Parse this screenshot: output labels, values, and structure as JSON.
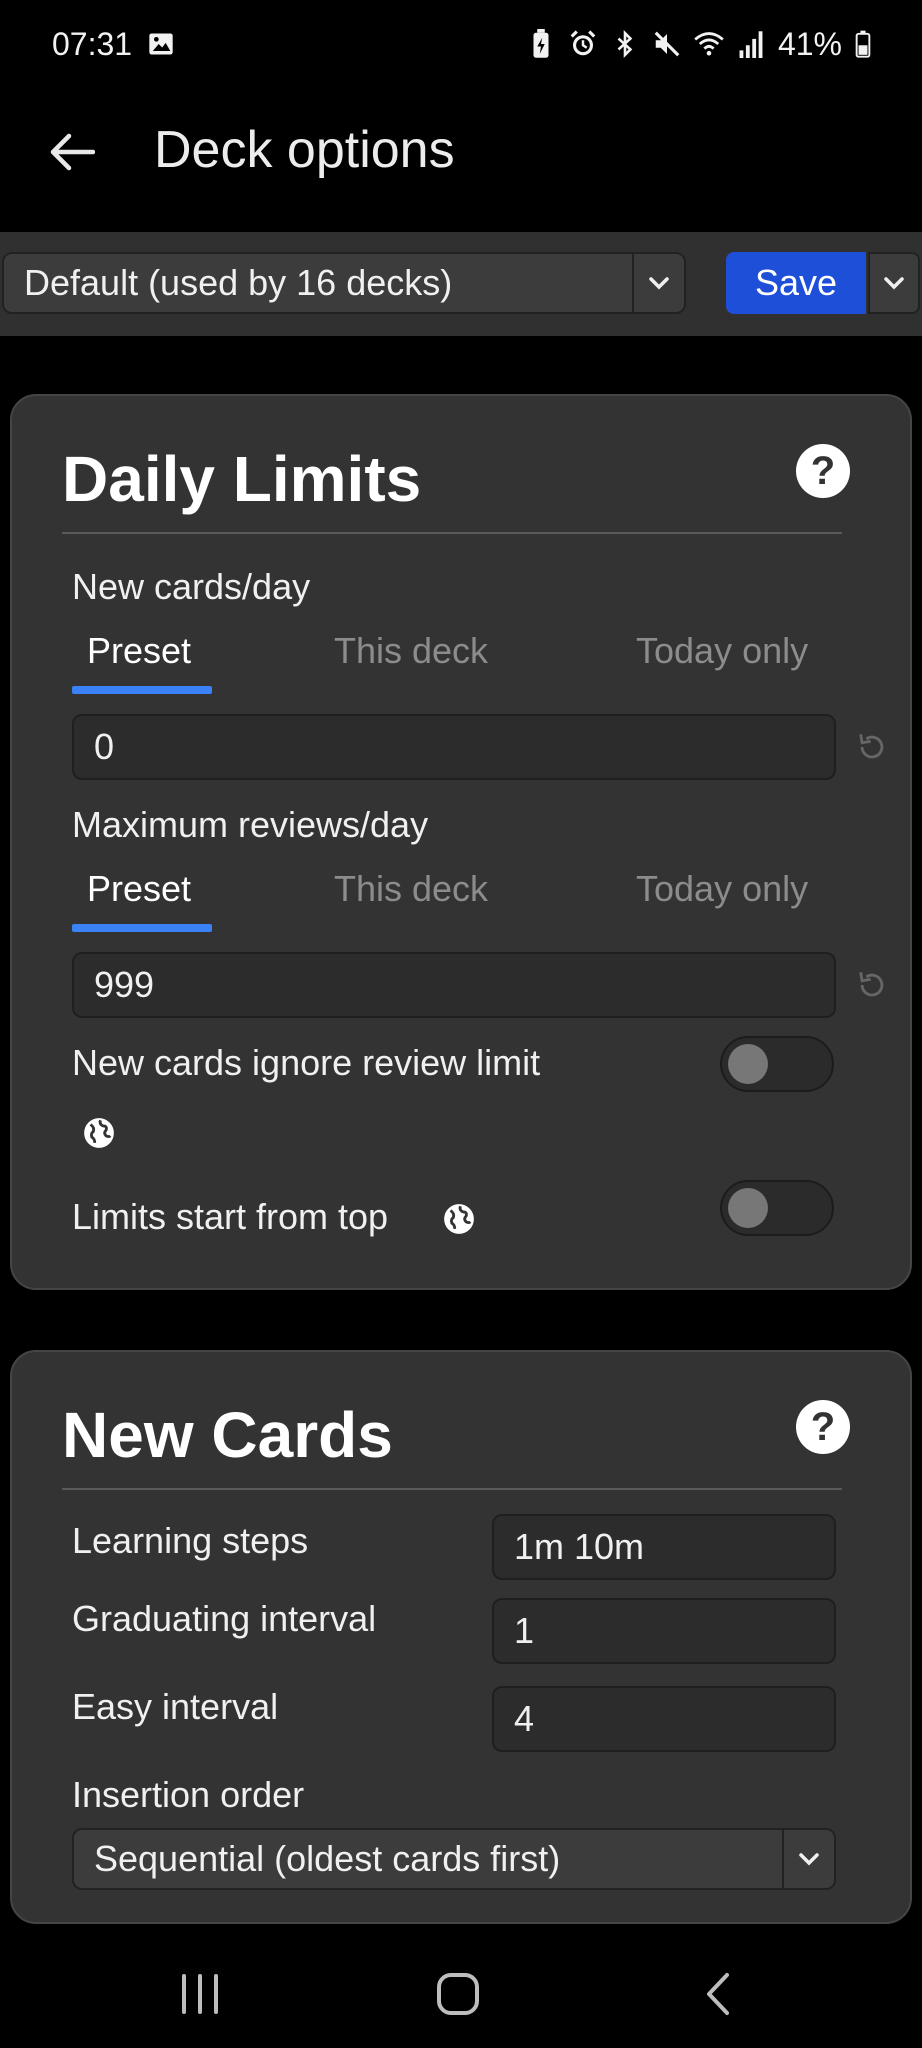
{
  "status_bar": {
    "time": "07:31",
    "battery": "41%",
    "icons": [
      "image-icon",
      "battery-saver-icon",
      "alarm-icon",
      "bluetooth-icon",
      "mute-icon",
      "wifi-icon",
      "signal-icon",
      "battery-icon"
    ]
  },
  "app_bar": {
    "title": "Deck options"
  },
  "toolbar": {
    "preset_value": "Default (used by 16 decks)",
    "save_label": "Save"
  },
  "daily_limits": {
    "title": "Daily Limits",
    "new_cards": {
      "label": "New cards/day",
      "tabs": [
        "Preset",
        "This deck",
        "Today only"
      ],
      "active_tab": "Preset",
      "value": "0"
    },
    "max_reviews": {
      "label": "Maximum reviews/day",
      "tabs": [
        "Preset",
        "This deck",
        "Today only"
      ],
      "active_tab": "Preset",
      "value": "999"
    },
    "ignore_review_limit": {
      "label": "New cards ignore review limit",
      "enabled": false
    },
    "limits_from_top": {
      "label": "Limits start from top",
      "enabled": false
    }
  },
  "new_cards": {
    "title": "New Cards",
    "learning_steps": {
      "label": "Learning steps",
      "value": "1m 10m"
    },
    "graduating_interval": {
      "label": "Graduating interval",
      "value": "1"
    },
    "easy_interval": {
      "label": "Easy interval",
      "value": "4"
    },
    "insertion_order": {
      "label": "Insertion order",
      "value": "Sequential (oldest cards first)"
    }
  },
  "colors": {
    "accent": "#3b82f6",
    "save_button": "#1e4fd8",
    "card_bg": "#333333",
    "background": "#000000"
  }
}
